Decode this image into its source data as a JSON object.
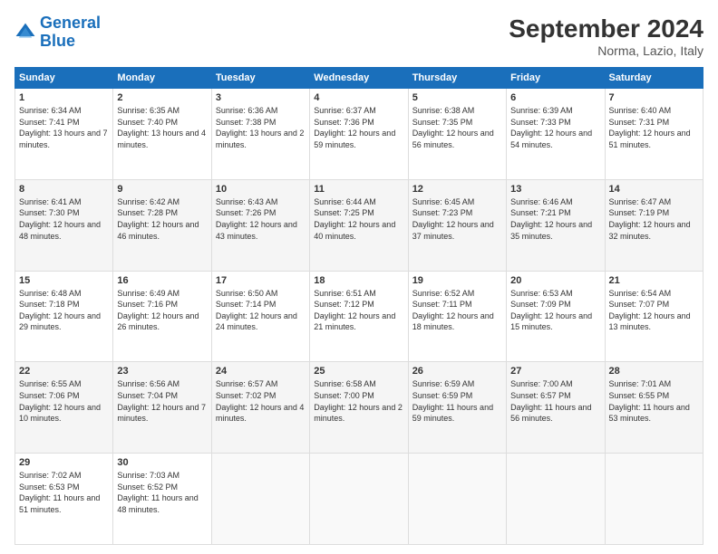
{
  "logo": {
    "line1": "General",
    "line2": "Blue"
  },
  "title": "September 2024",
  "location": "Norma, Lazio, Italy",
  "weekdays": [
    "Sunday",
    "Monday",
    "Tuesday",
    "Wednesday",
    "Thursday",
    "Friday",
    "Saturday"
  ],
  "weeks": [
    [
      {
        "day": "1",
        "sunrise": "Sunrise: 6:34 AM",
        "sunset": "Sunset: 7:41 PM",
        "daylight": "Daylight: 13 hours and 7 minutes."
      },
      {
        "day": "2",
        "sunrise": "Sunrise: 6:35 AM",
        "sunset": "Sunset: 7:40 PM",
        "daylight": "Daylight: 13 hours and 4 minutes."
      },
      {
        "day": "3",
        "sunrise": "Sunrise: 6:36 AM",
        "sunset": "Sunset: 7:38 PM",
        "daylight": "Daylight: 13 hours and 2 minutes."
      },
      {
        "day": "4",
        "sunrise": "Sunrise: 6:37 AM",
        "sunset": "Sunset: 7:36 PM",
        "daylight": "Daylight: 12 hours and 59 minutes."
      },
      {
        "day": "5",
        "sunrise": "Sunrise: 6:38 AM",
        "sunset": "Sunset: 7:35 PM",
        "daylight": "Daylight: 12 hours and 56 minutes."
      },
      {
        "day": "6",
        "sunrise": "Sunrise: 6:39 AM",
        "sunset": "Sunset: 7:33 PM",
        "daylight": "Daylight: 12 hours and 54 minutes."
      },
      {
        "day": "7",
        "sunrise": "Sunrise: 6:40 AM",
        "sunset": "Sunset: 7:31 PM",
        "daylight": "Daylight: 12 hours and 51 minutes."
      }
    ],
    [
      {
        "day": "8",
        "sunrise": "Sunrise: 6:41 AM",
        "sunset": "Sunset: 7:30 PM",
        "daylight": "Daylight: 12 hours and 48 minutes."
      },
      {
        "day": "9",
        "sunrise": "Sunrise: 6:42 AM",
        "sunset": "Sunset: 7:28 PM",
        "daylight": "Daylight: 12 hours and 46 minutes."
      },
      {
        "day": "10",
        "sunrise": "Sunrise: 6:43 AM",
        "sunset": "Sunset: 7:26 PM",
        "daylight": "Daylight: 12 hours and 43 minutes."
      },
      {
        "day": "11",
        "sunrise": "Sunrise: 6:44 AM",
        "sunset": "Sunset: 7:25 PM",
        "daylight": "Daylight: 12 hours and 40 minutes."
      },
      {
        "day": "12",
        "sunrise": "Sunrise: 6:45 AM",
        "sunset": "Sunset: 7:23 PM",
        "daylight": "Daylight: 12 hours and 37 minutes."
      },
      {
        "day": "13",
        "sunrise": "Sunrise: 6:46 AM",
        "sunset": "Sunset: 7:21 PM",
        "daylight": "Daylight: 12 hours and 35 minutes."
      },
      {
        "day": "14",
        "sunrise": "Sunrise: 6:47 AM",
        "sunset": "Sunset: 7:19 PM",
        "daylight": "Daylight: 12 hours and 32 minutes."
      }
    ],
    [
      {
        "day": "15",
        "sunrise": "Sunrise: 6:48 AM",
        "sunset": "Sunset: 7:18 PM",
        "daylight": "Daylight: 12 hours and 29 minutes."
      },
      {
        "day": "16",
        "sunrise": "Sunrise: 6:49 AM",
        "sunset": "Sunset: 7:16 PM",
        "daylight": "Daylight: 12 hours and 26 minutes."
      },
      {
        "day": "17",
        "sunrise": "Sunrise: 6:50 AM",
        "sunset": "Sunset: 7:14 PM",
        "daylight": "Daylight: 12 hours and 24 minutes."
      },
      {
        "day": "18",
        "sunrise": "Sunrise: 6:51 AM",
        "sunset": "Sunset: 7:12 PM",
        "daylight": "Daylight: 12 hours and 21 minutes."
      },
      {
        "day": "19",
        "sunrise": "Sunrise: 6:52 AM",
        "sunset": "Sunset: 7:11 PM",
        "daylight": "Daylight: 12 hours and 18 minutes."
      },
      {
        "day": "20",
        "sunrise": "Sunrise: 6:53 AM",
        "sunset": "Sunset: 7:09 PM",
        "daylight": "Daylight: 12 hours and 15 minutes."
      },
      {
        "day": "21",
        "sunrise": "Sunrise: 6:54 AM",
        "sunset": "Sunset: 7:07 PM",
        "daylight": "Daylight: 12 hours and 13 minutes."
      }
    ],
    [
      {
        "day": "22",
        "sunrise": "Sunrise: 6:55 AM",
        "sunset": "Sunset: 7:06 PM",
        "daylight": "Daylight: 12 hours and 10 minutes."
      },
      {
        "day": "23",
        "sunrise": "Sunrise: 6:56 AM",
        "sunset": "Sunset: 7:04 PM",
        "daylight": "Daylight: 12 hours and 7 minutes."
      },
      {
        "day": "24",
        "sunrise": "Sunrise: 6:57 AM",
        "sunset": "Sunset: 7:02 PM",
        "daylight": "Daylight: 12 hours and 4 minutes."
      },
      {
        "day": "25",
        "sunrise": "Sunrise: 6:58 AM",
        "sunset": "Sunset: 7:00 PM",
        "daylight": "Daylight: 12 hours and 2 minutes."
      },
      {
        "day": "26",
        "sunrise": "Sunrise: 6:59 AM",
        "sunset": "Sunset: 6:59 PM",
        "daylight": "Daylight: 11 hours and 59 minutes."
      },
      {
        "day": "27",
        "sunrise": "Sunrise: 7:00 AM",
        "sunset": "Sunset: 6:57 PM",
        "daylight": "Daylight: 11 hours and 56 minutes."
      },
      {
        "day": "28",
        "sunrise": "Sunrise: 7:01 AM",
        "sunset": "Sunset: 6:55 PM",
        "daylight": "Daylight: 11 hours and 53 minutes."
      }
    ],
    [
      {
        "day": "29",
        "sunrise": "Sunrise: 7:02 AM",
        "sunset": "Sunset: 6:53 PM",
        "daylight": "Daylight: 11 hours and 51 minutes."
      },
      {
        "day": "30",
        "sunrise": "Sunrise: 7:03 AM",
        "sunset": "Sunset: 6:52 PM",
        "daylight": "Daylight: 11 hours and 48 minutes."
      },
      null,
      null,
      null,
      null,
      null
    ]
  ]
}
